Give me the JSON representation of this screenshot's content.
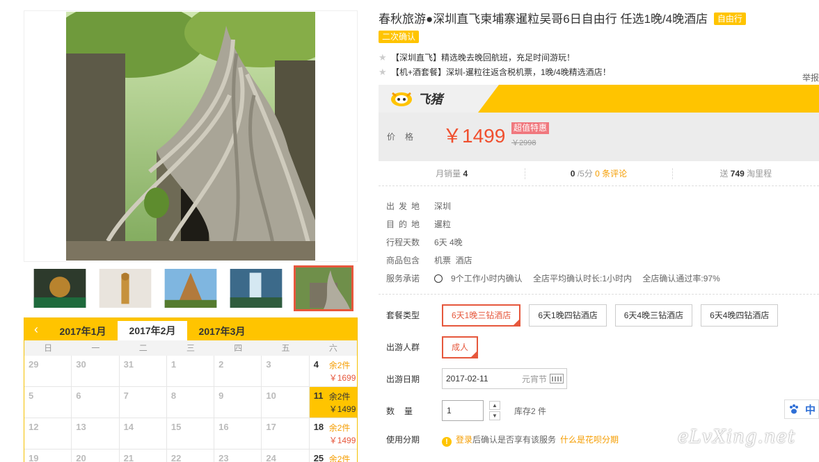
{
  "product": {
    "title": "春秋旅游●深圳直飞柬埔寨暹粒吴哥6日自由行 任选1晚/4晚酒店",
    "tag_free": "自由行",
    "tag_confirm": "二次确认",
    "selling_points": [
      "【深圳直飞】精选晚去晚回航班，充足时间游玩！",
      "【机+酒套餐】深圳-暹粒往返含税机票，1晚/4晚精选酒店！"
    ],
    "report": "举报"
  },
  "brand": {
    "name": "飞猪",
    "logo_icon": "fliggy-logo-icon"
  },
  "price": {
    "label": "价格",
    "current": "￥1499",
    "badge": "超值特惠",
    "original": "￥2998"
  },
  "stats": {
    "monthly_sales_label": "月销量",
    "monthly_sales": "4",
    "rating": "0",
    "rating_suffix": "/5分",
    "reviews": "0 条评论",
    "points_prefix": "送",
    "points": "749",
    "points_suffix": "淘里程"
  },
  "details": [
    {
      "key": "出发地",
      "value": "深圳"
    },
    {
      "key": "目的地",
      "value": "暹粒"
    },
    {
      "key": "行程天数",
      "value": "6天 4晚"
    },
    {
      "key": "商品包含",
      "value": "机票  酒店"
    }
  ],
  "service": {
    "key": "服务承诺",
    "items": [
      "9个工作小时内确认",
      "全店平均确认时长:1小时内",
      "全店确认通过率:97%"
    ]
  },
  "options": {
    "package_label": "套餐类型",
    "packages": [
      "6天1晚三钻酒店",
      "6天1晚四钻酒店",
      "6天4晚三钻酒店",
      "6天4晚四钻酒店"
    ],
    "traveler_label": "出游人群",
    "travelers": [
      "成人"
    ],
    "date_label": "出游日期",
    "date_value": "2017-02-11",
    "date_holiday": "元宵节",
    "qty_label": "数量",
    "qty_value": "1",
    "stock": "库存2 件",
    "installment_label": "使用分期",
    "installment_login": "登录",
    "installment_text": "后确认是否享有该服务",
    "installment_link": "什么是花呗分期"
  },
  "calendar": {
    "prev": "‹",
    "next": "›",
    "months": [
      "2017年1月",
      "2017年2月",
      "2017年3月"
    ],
    "active_month": 1,
    "weekdays": [
      "日",
      "一",
      "二",
      "三",
      "四",
      "五",
      "六"
    ],
    "cells": [
      {
        "d": "29"
      },
      {
        "d": "30"
      },
      {
        "d": "31"
      },
      {
        "d": "1"
      },
      {
        "d": "2"
      },
      {
        "d": "3"
      },
      {
        "d": "4",
        "left": "余2件",
        "price": "￥1699"
      },
      {
        "d": "5"
      },
      {
        "d": "6"
      },
      {
        "d": "7"
      },
      {
        "d": "8"
      },
      {
        "d": "9"
      },
      {
        "d": "10"
      },
      {
        "d": "11",
        "left": "余2件",
        "price": "￥1499",
        "selected": true
      },
      {
        "d": "12"
      },
      {
        "d": "13"
      },
      {
        "d": "14"
      },
      {
        "d": "15"
      },
      {
        "d": "16"
      },
      {
        "d": "17"
      },
      {
        "d": "18",
        "left": "余2件",
        "price": "￥1499"
      },
      {
        "d": "19"
      },
      {
        "d": "20"
      },
      {
        "d": "21"
      },
      {
        "d": "22"
      },
      {
        "d": "23"
      },
      {
        "d": "24"
      },
      {
        "d": "25",
        "left": "余2件"
      }
    ]
  },
  "side": {
    "lang": "中"
  },
  "watermark": "eLvXing.net"
}
